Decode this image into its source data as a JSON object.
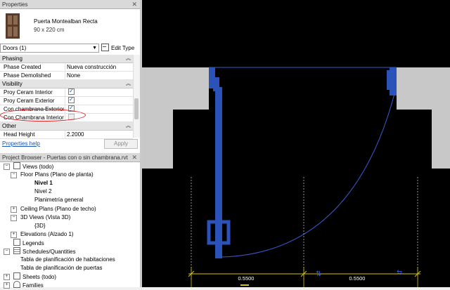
{
  "properties": {
    "title": "Properties",
    "type_name": "Puerta Montealban Recta",
    "type_size": "90 x 220 cm",
    "selector": "Doors (1)",
    "edit_type": "Edit Type",
    "groups": [
      {
        "name": "Phasing",
        "rows": [
          {
            "k": "Phase Created",
            "v": "Nueva construcción"
          },
          {
            "k": "Phase Demolished",
            "v": "None"
          }
        ]
      },
      {
        "name": "Visibility",
        "rows": [
          {
            "k": "Proy Ceram Interior",
            "checked": true
          },
          {
            "k": "Proy Ceram Exterior",
            "checked": true
          },
          {
            "k": "Con chambrana Exterior",
            "checked": true
          },
          {
            "k": "Con Chambrana Interior",
            "checked": false
          }
        ]
      },
      {
        "name": "Other",
        "rows": [
          {
            "k": "Head Height",
            "v": "2.2000"
          }
        ]
      }
    ],
    "help_link": "Properties help",
    "apply": "Apply"
  },
  "project_browser": {
    "title": "Project Browser - Puertas con o sin chambrana.rvt",
    "items": [
      {
        "label": "Views (todo)",
        "level": 0,
        "toggle": "-",
        "icon": "views"
      },
      {
        "label": "Floor Plans (Plano de planta)",
        "level": 1,
        "toggle": "-"
      },
      {
        "label": "Nivel 1",
        "level": 2,
        "bold": true
      },
      {
        "label": "Nivel 2",
        "level": 2
      },
      {
        "label": "Planimetría general",
        "level": 2
      },
      {
        "label": "Ceiling Plans (Plano de techo)",
        "level": 1,
        "toggle": "+"
      },
      {
        "label": "3D Views (Vista 3D)",
        "level": 1,
        "toggle": "-"
      },
      {
        "label": "{3D}",
        "level": 2
      },
      {
        "label": "Elevations (Alzado 1)",
        "level": 1,
        "toggle": "+"
      },
      {
        "label": "Legends",
        "level": 0,
        "toggle": "",
        "icon": "legend"
      },
      {
        "label": "Schedules/Quantities",
        "level": 0,
        "toggle": "-",
        "icon": "sched"
      },
      {
        "label": "Tabla de planificación de habitaciones",
        "level": 1
      },
      {
        "label": "Tabla de planificación de puertas",
        "level": 1
      },
      {
        "label": "Sheets (todo)",
        "level": 0,
        "toggle": "+",
        "icon": "sheet"
      },
      {
        "label": "Families",
        "level": 0,
        "toggle": "+",
        "icon": "fam"
      }
    ]
  },
  "drawing": {
    "dim_left": "0.5500",
    "dim_right": "0.5500",
    "colors": {
      "wall_fill": "#c8c8c8",
      "door_blue": "#2a52b8",
      "line_blue": "#3a5ad0",
      "dim_yellow": "#d8c400"
    }
  }
}
